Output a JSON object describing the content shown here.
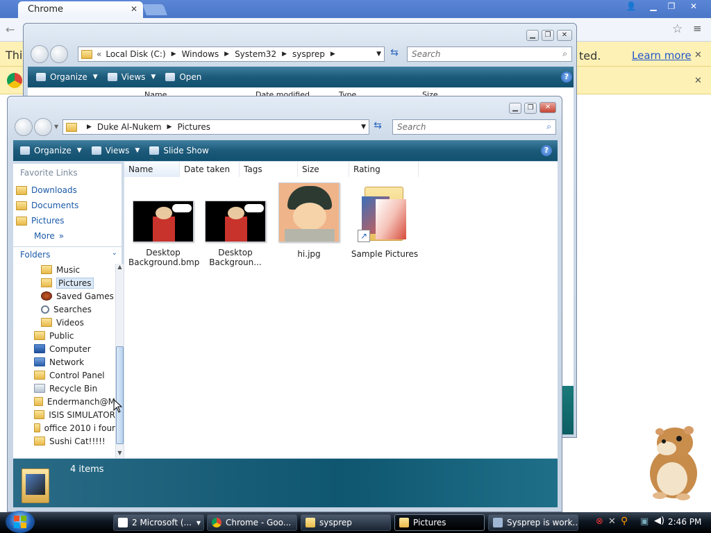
{
  "chrome": {
    "tab_title": "Chrome",
    "info_left": "This",
    "info_right": "ted.",
    "learn_more": "Learn more"
  },
  "back_explorer": {
    "path": [
      "Local Disk (C:)",
      "Windows",
      "System32",
      "sysprep"
    ],
    "search_placeholder": "Search",
    "commands": {
      "organize": "Organize",
      "views": "Views",
      "open": "Open"
    },
    "columns": [
      "Name",
      "Date modified",
      "Type",
      "Size"
    ]
  },
  "explorer": {
    "path": [
      "Duke Al-Nukem",
      "Pictures"
    ],
    "search_placeholder": "Search",
    "commands": {
      "organize": "Organize",
      "views": "Views",
      "slideshow": "Slide Show"
    },
    "favorite_links_title": "Favorite Links",
    "favorite_links": [
      "Downloads",
      "Documents",
      "Pictures"
    ],
    "more": "More",
    "folders_title": "Folders",
    "tree": [
      {
        "label": "Music",
        "indent": 1
      },
      {
        "label": "Pictures",
        "indent": 1,
        "selected": true
      },
      {
        "label": "Saved Games",
        "indent": 1
      },
      {
        "label": "Searches",
        "indent": 1
      },
      {
        "label": "Videos",
        "indent": 1
      },
      {
        "label": "Public",
        "indent": 0
      },
      {
        "label": "Computer",
        "indent": 0
      },
      {
        "label": "Network",
        "indent": 0
      },
      {
        "label": "Control Panel",
        "indent": 0
      },
      {
        "label": "Recycle Bin",
        "indent": 0
      },
      {
        "label": "Endermanch@M",
        "indent": 0
      },
      {
        "label": "ISIS SIMULATOR",
        "indent": 0
      },
      {
        "label": "office 2010 i four",
        "indent": 0
      },
      {
        "label": "Sushi Cat!!!!!",
        "indent": 0
      }
    ],
    "columns": [
      "Name",
      "Date taken",
      "Tags",
      "Size",
      "Rating"
    ],
    "files": [
      {
        "line1": "Desktop",
        "line2": "Background.bmp"
      },
      {
        "line1": "Desktop",
        "line2": "Backgroun..."
      },
      {
        "line1": "hi.jpg",
        "line2": ""
      },
      {
        "line1": "Sample Pictures",
        "line2": ""
      }
    ],
    "status": "4 items"
  },
  "taskbar": {
    "buttons": [
      {
        "label": "2 Microsoft (...",
        "active": false
      },
      {
        "label": "Chrome - Goo...",
        "active": false
      },
      {
        "label": "sysprep",
        "active": false
      },
      {
        "label": "Pictures",
        "active": true
      },
      {
        "label": "Sysprep is work...",
        "active": false
      }
    ],
    "clock": "2:46 PM"
  },
  "colors": {
    "command_bar": "#1d5a7a",
    "taskbar": "#0d1722",
    "infobar": "#fdf1b5",
    "link": "#1a5aa8"
  },
  "icons": [
    "folder-icon",
    "search-icon",
    "refresh-icon",
    "help-icon",
    "windows-start-icon",
    "hamster-mascot"
  ]
}
